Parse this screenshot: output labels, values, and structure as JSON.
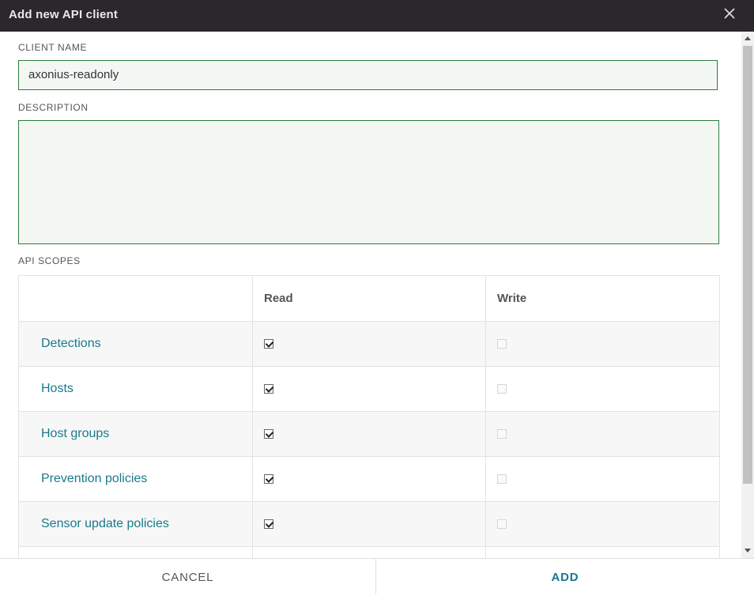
{
  "dialog": {
    "title": "Add new API client"
  },
  "form": {
    "client_name_label": "CLIENT NAME",
    "client_name_value": "axonius-readonly",
    "description_label": "DESCRIPTION",
    "description_value": "",
    "api_scopes_label": "API SCOPES"
  },
  "scopes": {
    "columns": [
      "",
      "Read",
      "Write"
    ],
    "rows": [
      {
        "name": "Detections",
        "read": true,
        "write": false
      },
      {
        "name": "Hosts",
        "read": true,
        "write": false
      },
      {
        "name": "Host groups",
        "read": true,
        "write": false
      },
      {
        "name": "Prevention policies",
        "read": true,
        "write": false
      },
      {
        "name": "Sensor update policies",
        "read": true,
        "write": false
      }
    ]
  },
  "footer": {
    "cancel_label": "CANCEL",
    "add_label": "ADD"
  },
  "colors": {
    "titlebar": "#2b282c",
    "input_border": "#2e7d3c",
    "accent": "#1a7a8a"
  }
}
